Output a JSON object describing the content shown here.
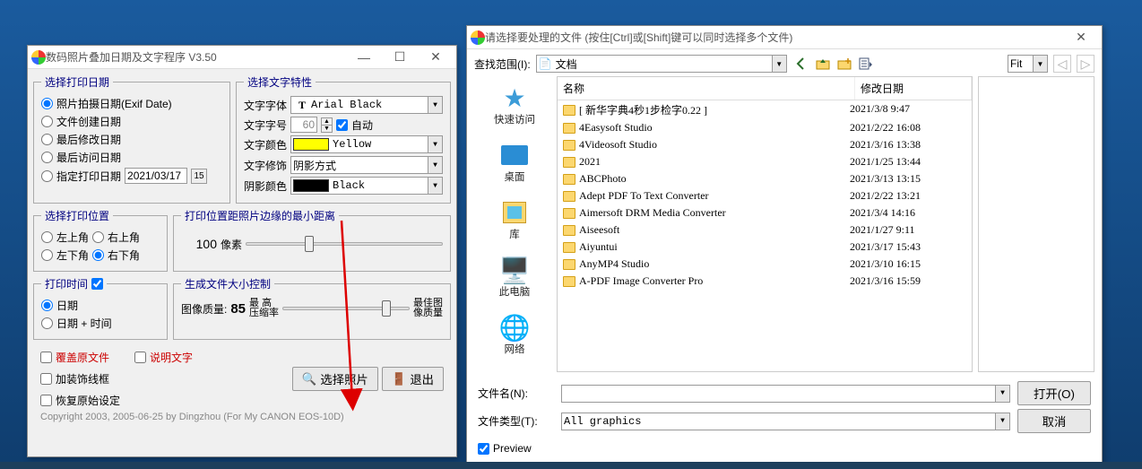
{
  "win1": {
    "title": "数码照片叠加日期及文字程序  V3.50",
    "date_group": {
      "legend": "选择打印日期",
      "opt1": "照片拍摄日期(Exif Date)",
      "opt2": "文件创建日期",
      "opt3": "最后修改日期",
      "opt4": "最后访问日期",
      "opt5": "指定打印日期",
      "date_value": "2021/03/17"
    },
    "text_group": {
      "legend": "选择文字特性",
      "font_label": "文字字体",
      "font_value": "Arial Black",
      "size_label": "文字字号",
      "size_value": "60",
      "auto_label": "自动",
      "color_label": "文字颜色",
      "color_value": "Yellow",
      "deco_label": "文字修饰",
      "deco_value": "阴影方式",
      "shadow_label": "阴影颜色",
      "shadow_value": "Black"
    },
    "pos_group": {
      "legend": "选择打印位置",
      "o1": "左上角",
      "o2": "右上角",
      "o3": "左下角",
      "o4": "右下角"
    },
    "margin_group": {
      "legend": "打印位置距照片边缘的最小距离",
      "value": "100",
      "unit": "像素"
    },
    "time_group": {
      "legend": "打印时间",
      "o1": "日期",
      "o2": "日期 + 时间"
    },
    "size_group": {
      "legend": "生成文件大小控制",
      "q_label": "图像质量:",
      "q_value": "85",
      "left1": "最 高",
      "left2": "压缩率",
      "right1": "最佳图",
      "right2": "像质量"
    },
    "check1": "覆盖原文件",
    "check2": "说明文字",
    "check3": "加装饰线框",
    "check4": "恢复原始设定",
    "btn_select": "选择照片",
    "btn_exit": "退出",
    "copyright": "Copyright 2003, 2005-06-25 by Dingzhou    (For My CANON EOS-10D)"
  },
  "win2": {
    "title": "请选择要处理的文件 (按住[Ctrl]或[Shift]键可以同时选择多个文件)",
    "look_in": "查找范围(I):",
    "look_value": "文档",
    "fit_label": "Fit",
    "places": {
      "p1": "快速访问",
      "p2": "桌面",
      "p3": "库",
      "p4": "此电脑",
      "p5": "网络"
    },
    "cols": {
      "name": "名称",
      "date": "修改日期"
    },
    "files": [
      {
        "name": "[ 新华字典4秒1步检字0.22 ]",
        "date": "2021/3/8 9:47"
      },
      {
        "name": "4Easysoft Studio",
        "date": "2021/2/22 16:08"
      },
      {
        "name": "4Videosoft Studio",
        "date": "2021/3/16 13:38"
      },
      {
        "name": "2021",
        "date": "2021/1/25 13:44"
      },
      {
        "name": "ABCPhoto",
        "date": "2021/3/13 13:15"
      },
      {
        "name": "Adept PDF To Text Converter",
        "date": "2021/2/22 13:21"
      },
      {
        "name": "Aimersoft DRM Media Converter",
        "date": "2021/3/4 14:16"
      },
      {
        "name": "Aiseesoft",
        "date": "2021/1/27 9:11"
      },
      {
        "name": "Aiyuntui",
        "date": "2021/3/17 15:43"
      },
      {
        "name": "AnyMP4 Studio",
        "date": "2021/3/10 16:15"
      },
      {
        "name": "A-PDF Image Converter Pro",
        "date": "2021/3/16 15:59"
      }
    ],
    "fname_label": "文件名(N):",
    "ftype_label": "文件类型(T):",
    "ftype_value": "All graphics",
    "btn_open": "打开(O)",
    "btn_cancel": "取消",
    "preview_label": "Preview"
  }
}
